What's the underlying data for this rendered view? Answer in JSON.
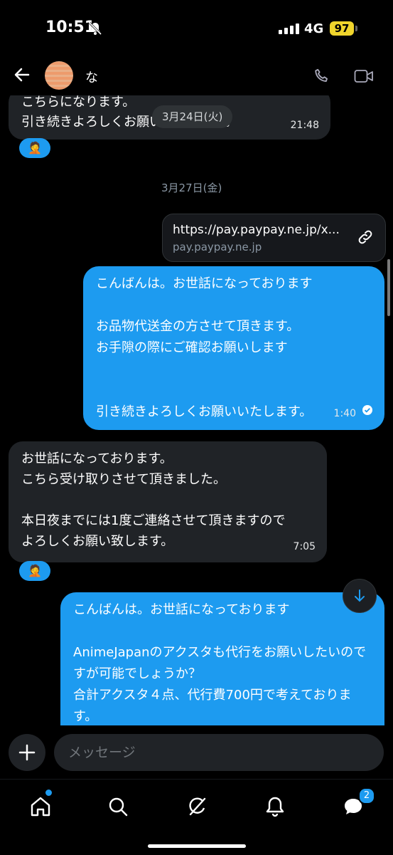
{
  "status": {
    "time": "10:51",
    "network": "4G",
    "battery": "97"
  },
  "header": {
    "contact_name": "な"
  },
  "chat": {
    "prev_message": {
      "text": "こちらになります。\n引き続きよろしくお願いいたします。",
      "time": "21:48",
      "reaction": "🤦"
    },
    "date_pill": "3月24日(火)",
    "date_separator": "3月27日(金)",
    "link_card": {
      "url": "https://pay.paypay.ne.jp/x...",
      "domain": "pay.paypay.ne.jp"
    },
    "out_message_1": {
      "text": "こんばんは。お世話になっております\n\nお品物代送金の方させて頂きます。\nお手隙の際にご確認お願いします\n\n\n引き続きよろしくお願いいたします。",
      "time": "1:40"
    },
    "in_message_1": {
      "text": "お世話になっております。\nこちら受け取りさせて頂きました。\n\n本日夜までには1度ご連絡させて頂きますので\nよろしくお願い致します。",
      "time": "7:05",
      "reaction": "🤦"
    },
    "out_message_2": {
      "text": "こんばんは。お世話になっております\n\nAnimeJapanのアクスタも代行をお願いしたいのですが可能でしょうか？\n合計アクスタ４点、代行費700円で考えております。"
    }
  },
  "composer": {
    "placeholder": "メッセージ"
  },
  "tabbar": {
    "messages_badge": "2"
  },
  "colors": {
    "accent": "#1d9bf0",
    "incoming_bubble": "#202327",
    "background": "#000000"
  }
}
